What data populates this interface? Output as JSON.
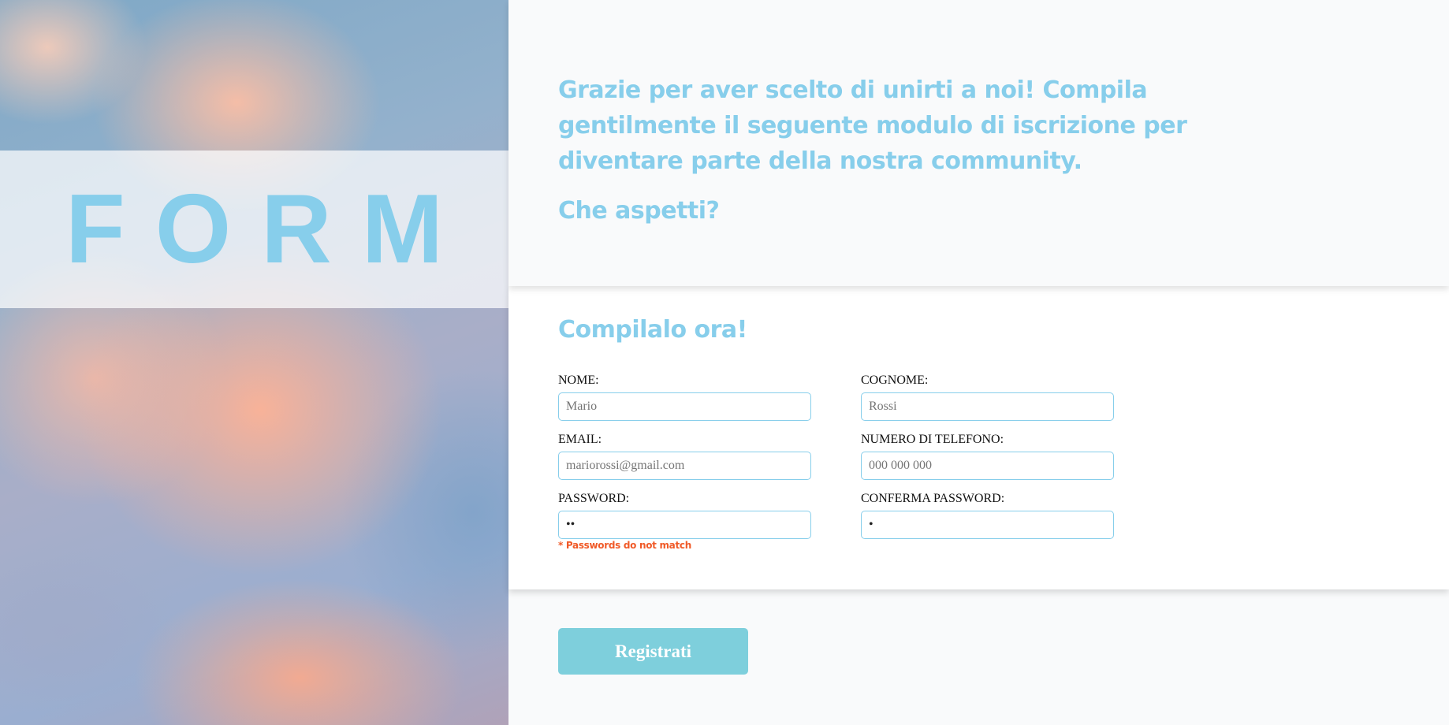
{
  "hero": {
    "title": "FORM"
  },
  "intro": {
    "text": "Grazie per aver scelto di unirti a noi! Compila gentilmente il seguente modulo di iscrizione per diventare parte della nostra community.",
    "question": "Che aspetti?"
  },
  "form": {
    "heading": "Compilalo ora!",
    "fields": {
      "nome": {
        "label": "NOME:",
        "placeholder": "Mario",
        "value": ""
      },
      "cognome": {
        "label": "COGNOME:",
        "placeholder": "Rossi",
        "value": ""
      },
      "email": {
        "label": "EMAIL:",
        "placeholder": "mariorossi@gmail.com",
        "value": ""
      },
      "telefono": {
        "label": "NUMERO DI TELEFONO:",
        "placeholder": "000 000 000",
        "value": ""
      },
      "password": {
        "label": "PASSWORD:",
        "value": "ab"
      },
      "conferma": {
        "label": "CONFERMA PASSWORD:",
        "value": "a"
      }
    },
    "error": "* Passwords do not match",
    "submit_label": "Registrati"
  },
  "colors": {
    "accent": "#87ceeb",
    "button": "#7ecfdc",
    "error": "#f05a28",
    "background": "#f9fafb"
  }
}
